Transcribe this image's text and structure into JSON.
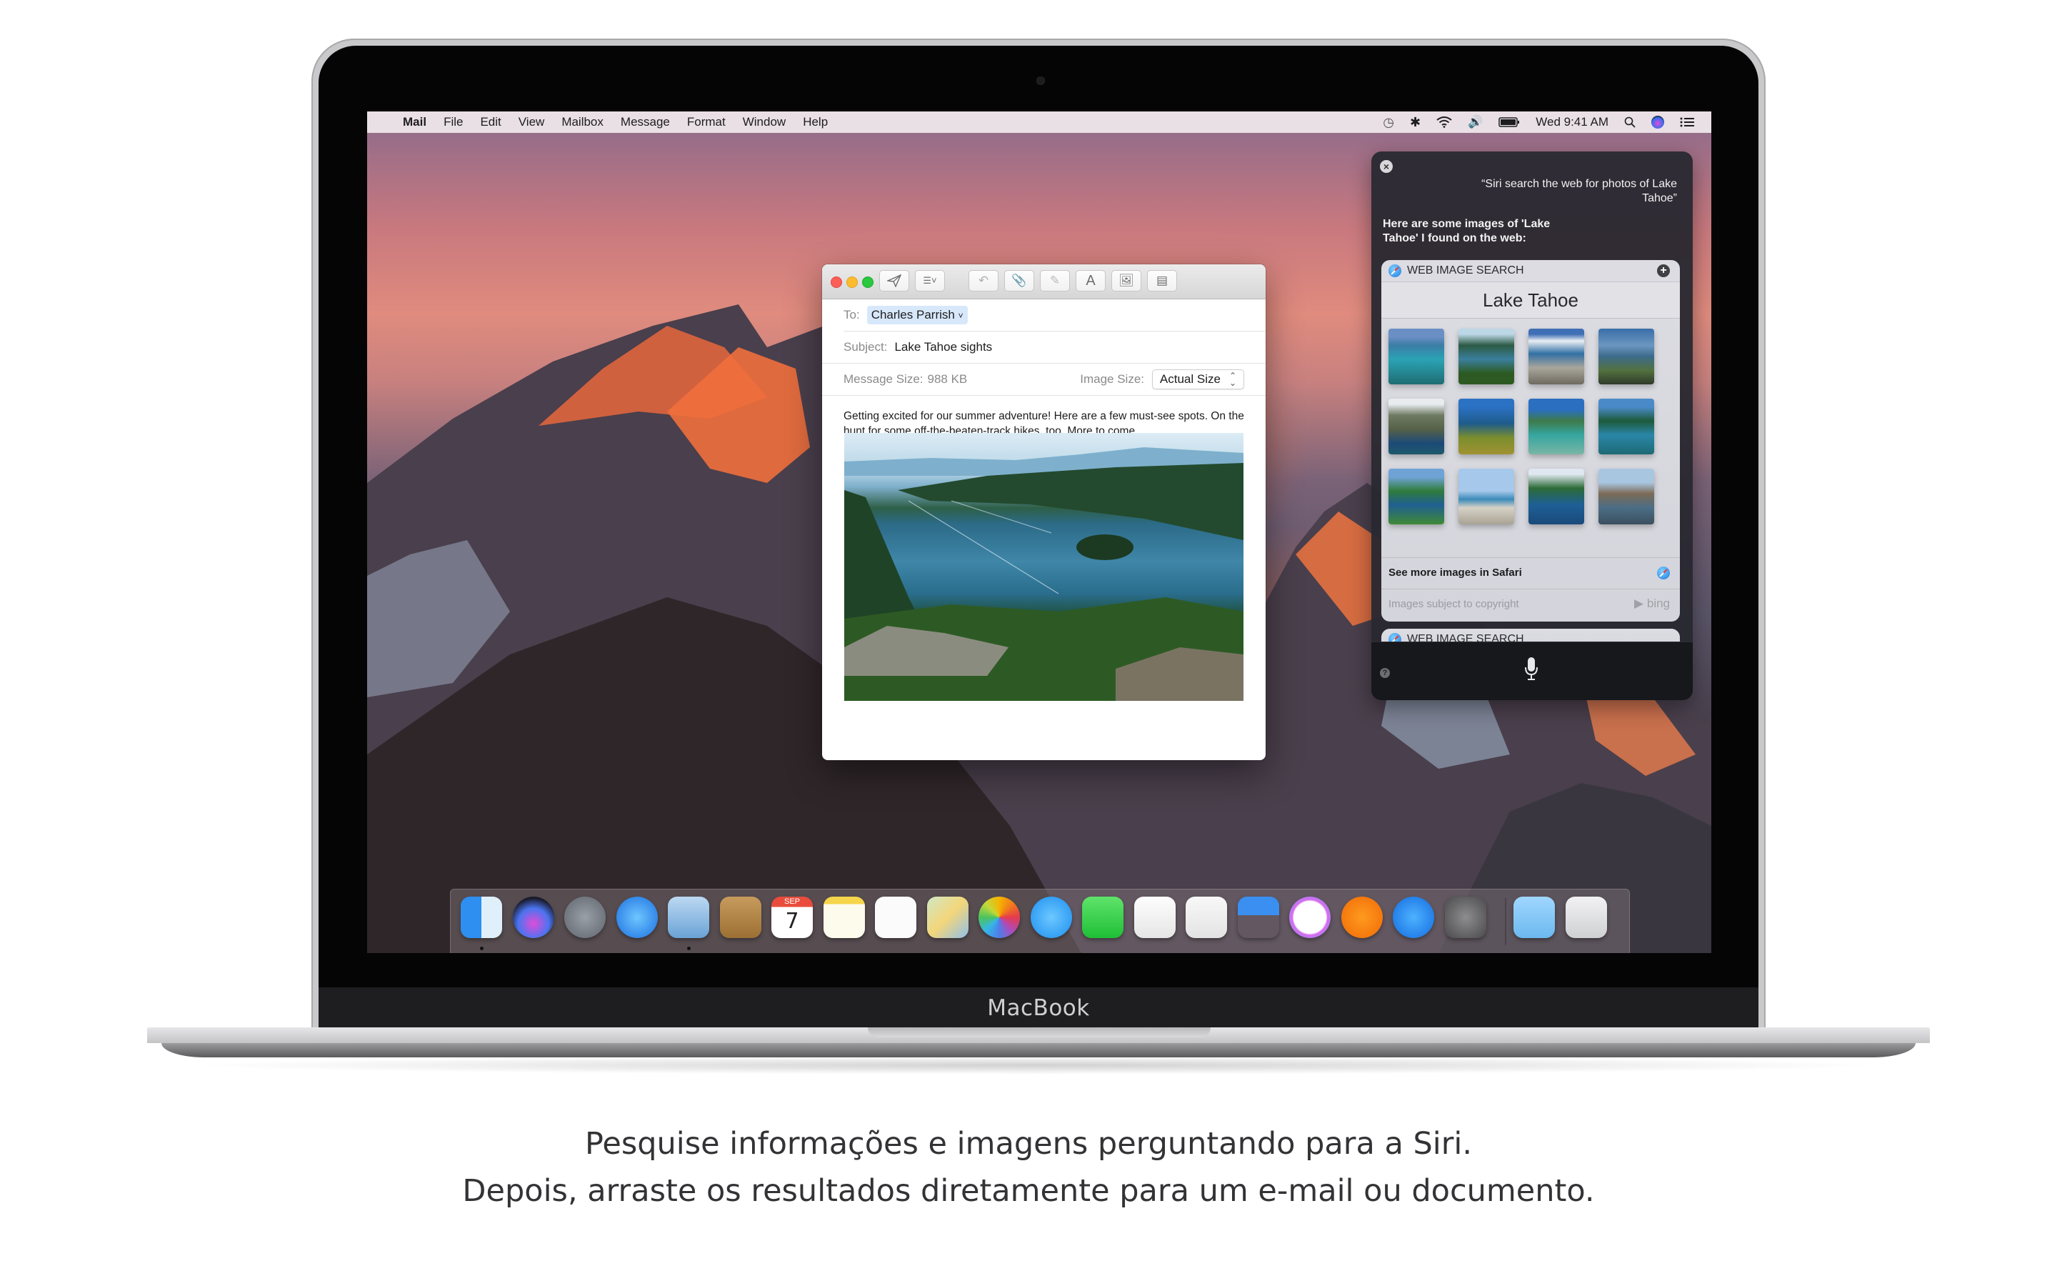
{
  "device": {
    "label": "MacBook"
  },
  "menubar": {
    "app_name": "Mail",
    "items": [
      "File",
      "Edit",
      "View",
      "Mailbox",
      "Message",
      "Format",
      "Window",
      "Help"
    ],
    "clock": "Wed 9:41 AM",
    "status_icons": [
      "time-machine-icon",
      "bluetooth-icon",
      "wifi-icon",
      "volume-icon",
      "battery-icon",
      "spotlight-icon",
      "siri-icon",
      "notification-center-icon"
    ]
  },
  "mail": {
    "to_label": "To:",
    "to_value": "Charles Parrish",
    "subject_label": "Subject:",
    "subject_value": "Lake Tahoe sights",
    "message_size_label": "Message Size:",
    "message_size_value": "988 KB",
    "image_size_label": "Image Size:",
    "image_size_value": "Actual Size",
    "body": "Getting excited for our summer adventure! Here are a few must-see spots. On the hunt for some off-the-beaten-track hikes, too. More to come...",
    "toolbar": [
      "send",
      "header-fields",
      "reply",
      "attach",
      "markup",
      "format-text",
      "photo-browser",
      "stationery"
    ],
    "toolbar_format_label": "A"
  },
  "siri": {
    "query": "“Siri search the web for photos of Lake Tahoe”",
    "response": "Here are some images of 'Lake Tahoe' I found on the web:",
    "card": {
      "header": "WEB IMAGE SEARCH",
      "title": "Lake Tahoe",
      "see_more": "See more images in Safari",
      "copyright": "Images subject to copyright",
      "provider": "bing"
    },
    "next_card_header": "WEB IMAGE SEARCH",
    "thumbnails": 12
  },
  "dock": {
    "apps": [
      "Finder",
      "Siri",
      "Launchpad",
      "Safari",
      "Mail",
      "Contacts",
      "Calendar",
      "Notes",
      "Reminders",
      "Maps",
      "Photos",
      "Messages",
      "FaceTime",
      "Pages",
      "Numbers",
      "Keynote",
      "iTunes",
      "iBooks",
      "App Store",
      "System Preferences",
      "Downloads",
      "Trash"
    ],
    "calendar_month": "SEP",
    "calendar_day": "7",
    "running": [
      "Finder",
      "Mail"
    ]
  },
  "caption": {
    "line1": "Pesquise informações e imagens perguntando para a Siri.",
    "line2": "Depois, arraste os resultados diretamente para um e-mail ou documento."
  }
}
